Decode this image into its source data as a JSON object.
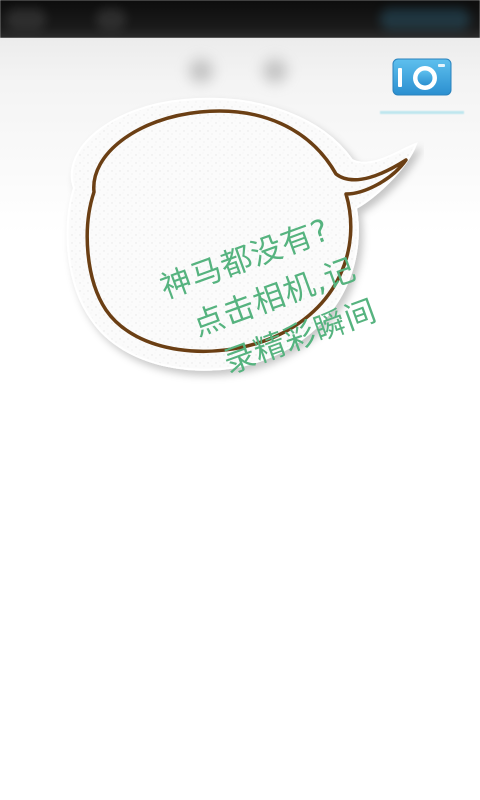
{
  "header": {
    "camera_icon": "camera-icon",
    "accent": "#3a9fd8"
  },
  "empty_state": {
    "lines": [
      "神马都没有?",
      "点击相机,记",
      "录精彩瞬间"
    ],
    "text_color": "#56b37f",
    "outline_color": "#6b3f14"
  }
}
